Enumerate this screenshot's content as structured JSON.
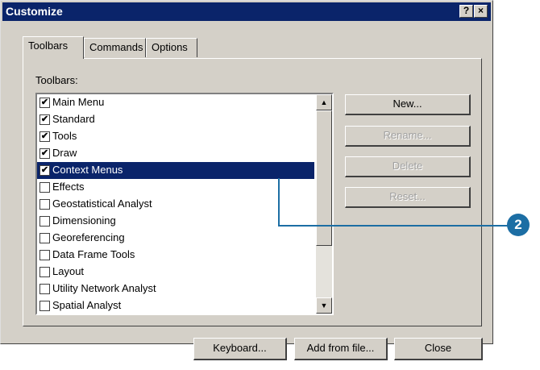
{
  "window": {
    "title": "Customize",
    "help_button": "?",
    "close_button": "×"
  },
  "tabs": [
    {
      "label": "Toolbars",
      "active": true
    },
    {
      "label": "Commands",
      "active": false
    },
    {
      "label": "Options",
      "active": false
    }
  ],
  "toolbars_label": "Toolbars:",
  "toolbar_list": [
    {
      "label": "Main Menu",
      "checked": true,
      "selected": false
    },
    {
      "label": "Standard",
      "checked": true,
      "selected": false
    },
    {
      "label": "Tools",
      "checked": true,
      "selected": false
    },
    {
      "label": "Draw",
      "checked": true,
      "selected": false
    },
    {
      "label": "Context Menus",
      "checked": true,
      "selected": true
    },
    {
      "label": "Effects",
      "checked": false,
      "selected": false
    },
    {
      "label": "Geostatistical Analyst",
      "checked": false,
      "selected": false
    },
    {
      "label": "Dimensioning",
      "checked": false,
      "selected": false
    },
    {
      "label": "Georeferencing",
      "checked": false,
      "selected": false
    },
    {
      "label": "Data Frame Tools",
      "checked": false,
      "selected": false
    },
    {
      "label": "Layout",
      "checked": false,
      "selected": false
    },
    {
      "label": "Utility Network Analyst",
      "checked": false,
      "selected": false
    },
    {
      "label": "Spatial Analyst",
      "checked": false,
      "selected": false
    }
  ],
  "side_buttons": {
    "new": "New...",
    "rename": "Rename...",
    "delete": "Delete",
    "reset": "Reset..."
  },
  "bottom_buttons": {
    "keyboard": "Keyboard...",
    "add_from_file": "Add from file...",
    "close": "Close"
  },
  "callout": {
    "number": "2",
    "color": "#1c6ea4"
  },
  "colors": {
    "dialog_bg": "#d4d0c8",
    "title_bar": "#0a246a",
    "selection": "#0a246a"
  }
}
